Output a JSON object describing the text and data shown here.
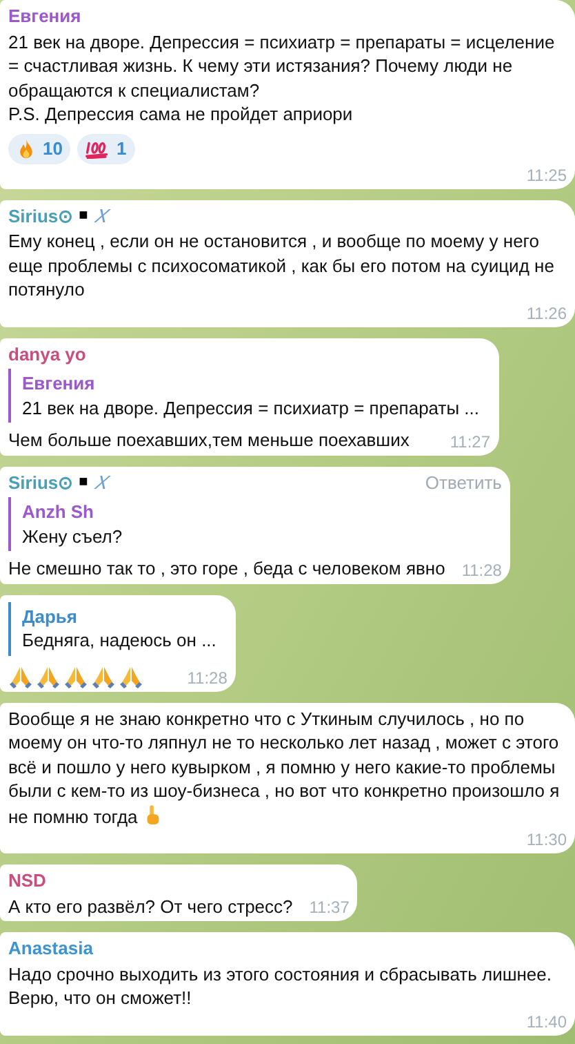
{
  "messages": [
    {
      "sender": "Евгения",
      "color": "#9b59c9",
      "text": "21 век на дворе. Депрессия = психиатр = препараты = исцеление = счастливая жизнь. К чему эти истязания? Почему люди не обращаются к специалистам?\nP.S. Депрессия сама не пройдет априори",
      "reactions": [
        {
          "kind": "fire",
          "count": "10"
        },
        {
          "kind": "hundred",
          "count": "1"
        }
      ],
      "time": "11:25"
    },
    {
      "sender": "Sirius⊙",
      "badges": [
        "■",
        "𝑋"
      ],
      "color": "#4a9fb5",
      "text": "Ему конец , если он не остановится , и вообще по моему у него еще проблемы с психосоматикой , как бы его потом на суицид не потянуло",
      "time": "11:26"
    },
    {
      "sender": "danya yo",
      "color": "#c84f7d",
      "reply": {
        "sender": "Евгения",
        "color": "#9b59c9",
        "text": "21 век на дворе. Депрессия = психиатр = препараты ..."
      },
      "text": "Чем больше поехавших,тем меньше поехавших",
      "time": "11:27"
    },
    {
      "sender": "Sirius⊙",
      "badges": [
        "■",
        "𝑋"
      ],
      "color": "#4a9fb5",
      "action": "Ответить",
      "reply": {
        "sender": "Anzh Sh",
        "color": "#9b59c9",
        "text": "Жену съел?"
      },
      "text": "Не смешно так то , это горе , беда с человеком явно",
      "time": "11:28"
    },
    {
      "kind": "emoji_only",
      "reply": {
        "sender": "Дарья",
        "color": "#3d8cc9",
        "text": "Бедняга, надеюсь он ..."
      },
      "time": "11:28"
    },
    {
      "kind": "text_with_emoji",
      "text": "Вообще я не знаю конкретно что с Уткиным случилось , но по моему он что-то ляпнул не то несколько лет назад , может с этого всё и пошло у него кувырком , я помню у него какие-то проблемы были с кем-то из шоу-бизнеса , но вот что конкретно произошло я не помню тогда",
      "time": "11:30"
    },
    {
      "sender": "NSD",
      "color": "#c84f7d",
      "text": "А кто его развёл? От чего стресс?",
      "time": "11:37"
    },
    {
      "sender": "Anastasia",
      "color": "#3d94cf",
      "text": "Надо срочно выходить из этого состояния и сбрасывать лишнее. Верю, что он сможет!!",
      "time": "11:40"
    }
  ]
}
